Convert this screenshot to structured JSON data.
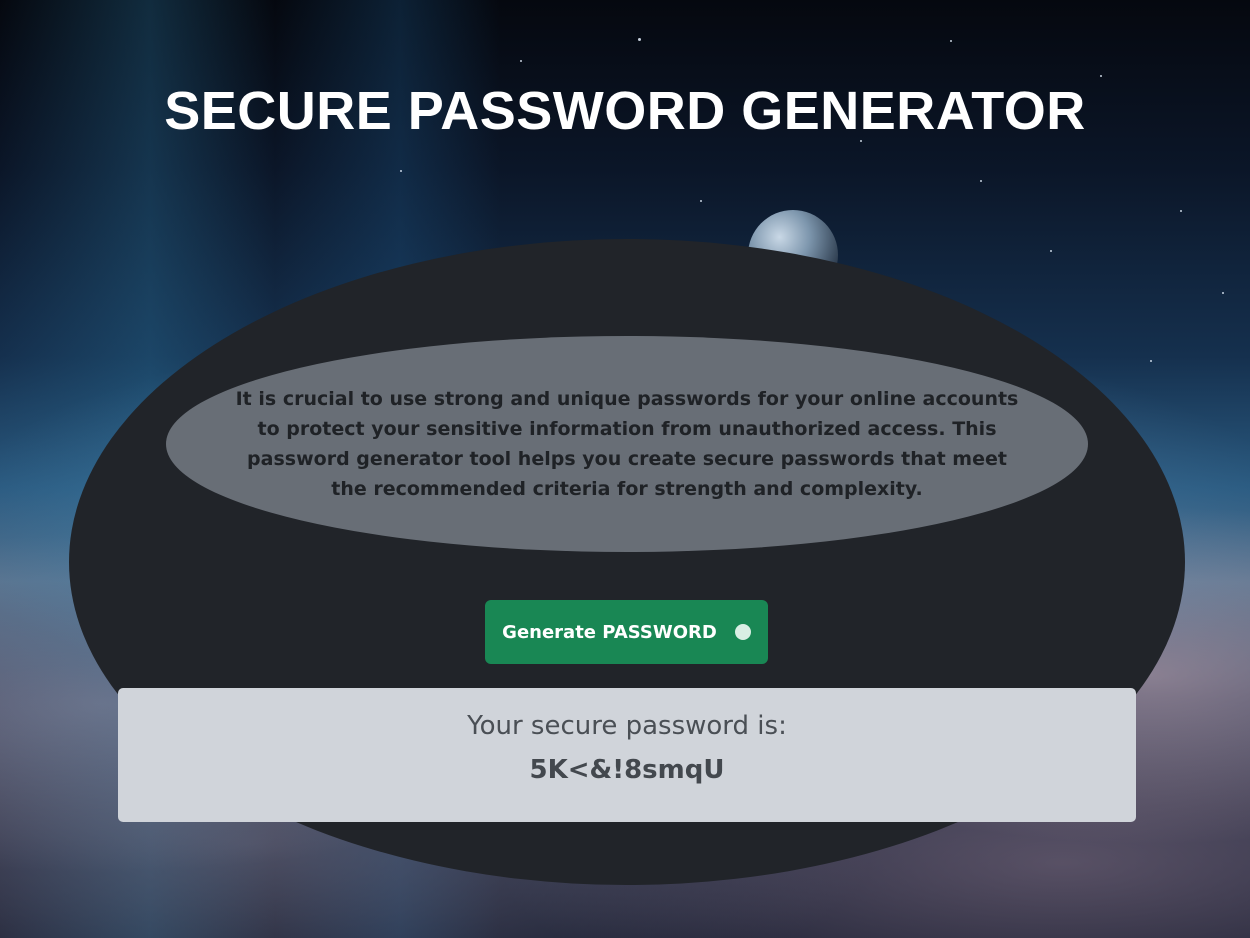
{
  "page": {
    "title": "SECURE PASSWORD GENERATOR"
  },
  "info": {
    "text": "It is crucial to use strong and unique passwords for your online accounts to protect your sensitive information from unauthorized access. This password generator tool helps you create secure passwords that meet the recommended criteria for strength and complexity."
  },
  "generate": {
    "label": "Generate PASSWORD",
    "indicator_icon": "circle-dot-icon",
    "color": "#198754"
  },
  "result": {
    "caption": "Your secure password is:",
    "password": "5K<&!8smqU"
  },
  "colors": {
    "card": "#212429",
    "info_bubble": "#686e76",
    "result_panel": "#d0d4da"
  }
}
